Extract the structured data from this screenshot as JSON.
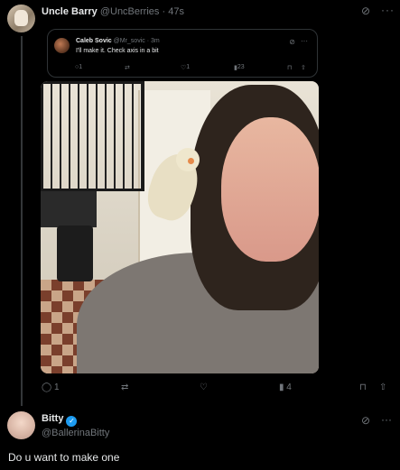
{
  "tweet": {
    "author_name": "Uncle Barry",
    "author_handle": "@UncBerries",
    "time": "47s",
    "icons": {
      "grok": "grok-icon",
      "more": "more-icon"
    },
    "quote": {
      "author_name": "Caleb Sovic",
      "author_handle": "@Mr_sovic",
      "time": "3m",
      "text": "I'll make it. Check axis in a bit",
      "reply_count": "1",
      "like_count": "1",
      "view_count": "23"
    },
    "media": {
      "description_icon": "photo"
    },
    "actions": {
      "reply_count": "1",
      "retweet_count": "",
      "like_count": "",
      "view_count": "4"
    }
  },
  "reply": {
    "author_name": "Bitty",
    "author_handle": "@BallerinaBitty",
    "text": "Do u want to make one",
    "verified": true
  },
  "colors": {
    "background": "#000000",
    "text": "#e7e9ea",
    "muted": "#71767b",
    "border": "#2f3336",
    "verified": "#1d9bf0"
  }
}
